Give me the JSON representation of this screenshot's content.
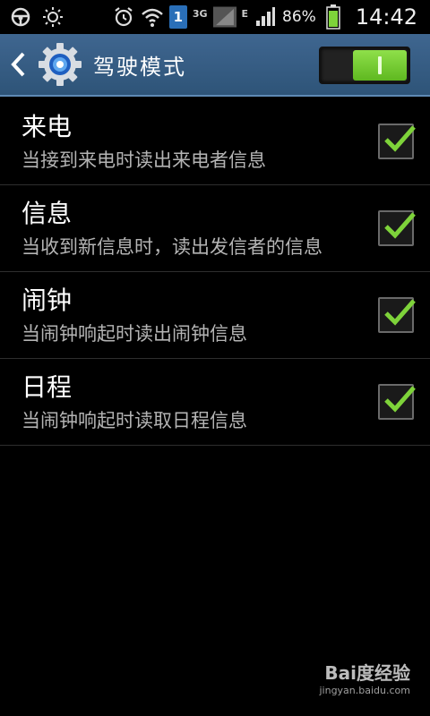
{
  "statusbar": {
    "sim_slot": "1",
    "network_3g": "3G",
    "network_e": "E",
    "battery_percent": "86%",
    "time": "14:42"
  },
  "actionbar": {
    "title": "驾驶模式",
    "switch_on": true
  },
  "settings": [
    {
      "title": "来电",
      "subtitle": "当接到来电时读出来电者信息",
      "checked": true
    },
    {
      "title": "信息",
      "subtitle": "当收到新信息时，读出发信者的信息",
      "checked": true
    },
    {
      "title": "闹钟",
      "subtitle": "当闹钟响起时读出闹钟信息",
      "checked": true
    },
    {
      "title": "日程",
      "subtitle": "当闹钟响起时读取日程信息",
      "checked": true
    }
  ],
  "watermark": {
    "logo": "Bai度经验",
    "url": "jingyan.baidu.com"
  },
  "colors": {
    "accent_green": "#7ed33a",
    "actionbar_blue": "#36608a"
  }
}
